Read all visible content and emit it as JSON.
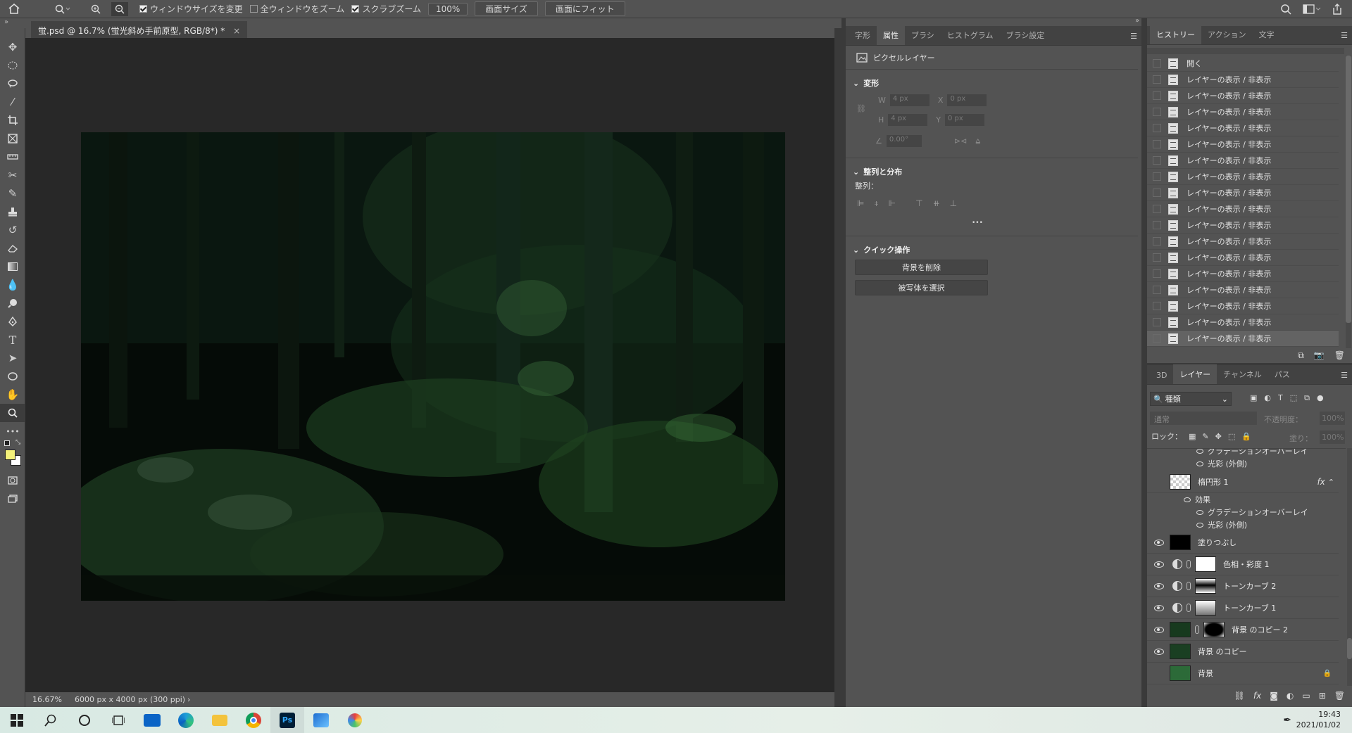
{
  "options_bar": {
    "home_icon": "home-icon",
    "zoom_tool_icon": "magnifier-icon",
    "zoom_in_icon": "zoom-in-icon",
    "zoom_out_icon": "zoom-out-icon",
    "resize_windows_label": "ウィンドウサイズを変更",
    "resize_windows_checked": true,
    "zoom_all_windows_label": "全ウィンドウをズーム",
    "zoom_all_windows_checked": false,
    "scrubby_zoom_label": "スクラブズーム",
    "scrubby_zoom_checked": true,
    "zoom_value": "100%",
    "fit_screen_label": "画面サイズ",
    "fill_screen_label": "画面にフィット"
  },
  "document": {
    "tab_title": "蛍.psd @ 16.7% (蛍光斜め手前原型, RGB/8*) *",
    "close_glyph": "×"
  },
  "status": {
    "zoom": "16.67%",
    "doc_size": "6000 px x 4000 px (300 ppi)",
    "arrow": "›"
  },
  "properties_panel": {
    "tabs": [
      "字形",
      "属性",
      "ブラシ",
      "ヒストグラム",
      "ブラシ設定"
    ],
    "active_tab": 1,
    "layer_kind": "ピクセルレイヤー",
    "transform_title": "変形",
    "w_label": "W",
    "w_value": "4 px",
    "x_label": "X",
    "x_value": "0 px",
    "h_label": "H",
    "h_value": "4 px",
    "y_label": "Y",
    "y_value": "0 px",
    "angle_value": "0.00°",
    "align_title": "整列と分布",
    "align_label": "整列：",
    "more_glyph": "•••",
    "quick_title": "クイック操作",
    "remove_bg_label": "背景を削除",
    "select_subject_label": "被写体を選択"
  },
  "history_panel": {
    "tabs": [
      "ヒストリー",
      "アクション",
      "文字"
    ],
    "active_tab": 0,
    "items": [
      "開く",
      "レイヤーの表示 / 非表示",
      "レイヤーの表示 / 非表示",
      "レイヤーの表示 / 非表示",
      "レイヤーの表示 / 非表示",
      "レイヤーの表示 / 非表示",
      "レイヤーの表示 / 非表示",
      "レイヤーの表示 / 非表示",
      "レイヤーの表示 / 非表示",
      "レイヤーの表示 / 非表示",
      "レイヤーの表示 / 非表示",
      "レイヤーの表示 / 非表示",
      "レイヤーの表示 / 非表示",
      "レイヤーの表示 / 非表示",
      "レイヤーの表示 / 非表示",
      "レイヤーの表示 / 非表示",
      "レイヤーの表示 / 非表示",
      "レイヤーの表示 / 非表示"
    ]
  },
  "layers_panel": {
    "tabs": [
      "3D",
      "レイヤー",
      "チャンネル",
      "パス"
    ],
    "active_tab": 1,
    "filter_label": "種類",
    "blend_mode": "通常",
    "opacity_label": "不透明度：",
    "opacity_value": "100%",
    "lock_label": "ロック：",
    "fill_label": "塗り：",
    "fill_value": "100%",
    "partial_effect_1": "グラデーションオーバーレイ",
    "partial_effect_2": "光彩 (外側)",
    "ellipse_layer": "楕円形 1",
    "fx_label": "fx",
    "effects_label": "効果",
    "effect_gradient": "グラデーションオーバーレイ",
    "effect_glow": "光彩 (外側)",
    "layers": [
      {
        "name": "塗りつぶし",
        "visible": true
      },
      {
        "name": "色相・彩度 1",
        "visible": true
      },
      {
        "name": "トーンカーブ 2",
        "visible": true
      },
      {
        "name": "トーンカーブ 1",
        "visible": true
      },
      {
        "name": "背景 のコピー 2",
        "visible": true
      },
      {
        "name": "背景 のコピー",
        "visible": true
      },
      {
        "name": "背景",
        "visible": false
      }
    ]
  },
  "taskbar": {
    "time": "19:43",
    "date": "2021/01/02",
    "ps_label": "Ps"
  },
  "colors": {
    "foreground": "#f4f27a",
    "background": "#ffffff",
    "ui_panel": "#535353",
    "canvas_bg": "#282828"
  }
}
